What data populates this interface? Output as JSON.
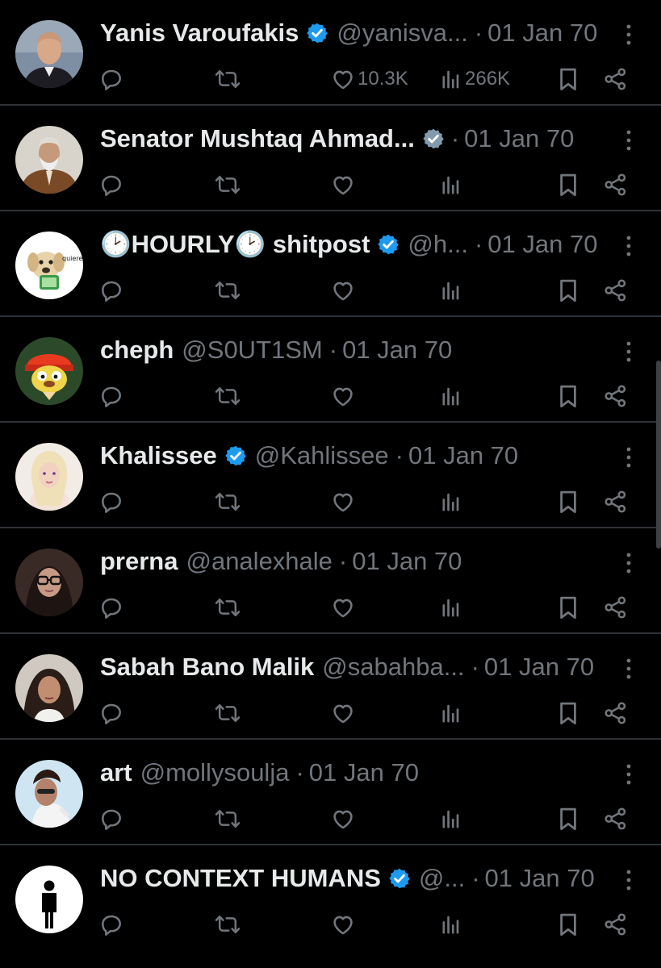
{
  "accent": "#1d9bf0",
  "verified_gray": "#829aab",
  "tweets": [
    {
      "name": "Yanis Varoufakis",
      "verified": "blue",
      "handle": "@yanisva...",
      "sep": "·",
      "time": "01 Jan 70",
      "likes": "10.3K",
      "views": "266K",
      "avatar": "avatar-yanis"
    },
    {
      "name": "Senator Mushtaq Ahmad...",
      "verified": "gray",
      "handle": "",
      "sep": "·",
      "time": "01 Jan 70",
      "likes": "",
      "views": "",
      "avatar": "avatar-senator"
    },
    {
      "name": "🕑HOURLY🕑 shitpost",
      "verified": "blue",
      "handle": "@h...",
      "sep": "·",
      "time": "01 Jan 70",
      "likes": "",
      "views": "",
      "avatar": "avatar-dog"
    },
    {
      "name": "cheph",
      "verified": "none",
      "handle": "@S0UT1SM",
      "sep": "·",
      "time": "01 Jan 70",
      "likes": "",
      "views": "",
      "avatar": "avatar-parappa"
    },
    {
      "name": "Khalissee",
      "verified": "blue",
      "handle": "@Kahlissee",
      "sep": "·",
      "time": "01 Jan 70",
      "likes": "",
      "views": "",
      "avatar": "avatar-khalissee"
    },
    {
      "name": "prerna",
      "verified": "none",
      "handle": "@analexhale",
      "sep": "·",
      "time": "01 Jan 70",
      "likes": "",
      "views": "",
      "avatar": "avatar-prerna"
    },
    {
      "name": "Sabah Bano Malik",
      "verified": "none",
      "handle": "@sabahba...",
      "sep": "·",
      "time": "01 Jan 70",
      "likes": "",
      "views": "",
      "avatar": "avatar-sabah"
    },
    {
      "name": "art",
      "verified": "none",
      "handle": "@mollysoulja",
      "sep": "·",
      "time": "01 Jan 70",
      "likes": "",
      "views": "",
      "avatar": "avatar-art"
    },
    {
      "name": "NO CONTEXT HUMANS",
      "verified": "blue",
      "handle": "@...",
      "sep": "·",
      "time": "01 Jan 70",
      "likes": "",
      "views": "",
      "avatar": "avatar-human"
    }
  ],
  "icons": [
    "reply-icon",
    "retweet-icon",
    "like-icon",
    "views-icon",
    "bookmark-icon",
    "share-icon",
    "more-icon",
    "verified-badge-icon"
  ]
}
